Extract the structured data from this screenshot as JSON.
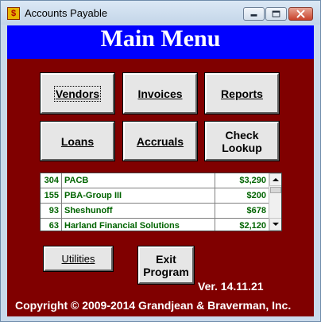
{
  "window": {
    "title": "Accounts Payable",
    "app_icon_glyph": "$"
  },
  "header": {
    "title": "Main Menu"
  },
  "menu_buttons": [
    {
      "label": "Vendors",
      "focused": true
    },
    {
      "label": "Invoices"
    },
    {
      "label": "Reports"
    },
    {
      "label": "Loans"
    },
    {
      "label": "Accruals"
    },
    {
      "label_line1": "Check",
      "label_line2": "Lookup"
    }
  ],
  "vendor_list": {
    "rows": [
      {
        "number": "304",
        "name": "PACB",
        "amount": "$3,290"
      },
      {
        "number": "155",
        "name": "PBA-Group III",
        "amount": "$200"
      },
      {
        "number": "93",
        "name": "Sheshunoff",
        "amount": "$678"
      },
      {
        "number": "63",
        "name": "Harland Financial Solutions",
        "amount": "$2,120"
      }
    ]
  },
  "utilities_button": {
    "label": "Utilities"
  },
  "exit_button": {
    "label_line1": "Exit",
    "label_line2": "Program"
  },
  "footer": {
    "version": "Ver. 14.11.21",
    "copyright": "Copyright © 2009-2014 Grandjean & Braverman, Inc."
  },
  "colors": {
    "background": "#800000",
    "header": "#0000ff",
    "list_text": "#006400"
  }
}
